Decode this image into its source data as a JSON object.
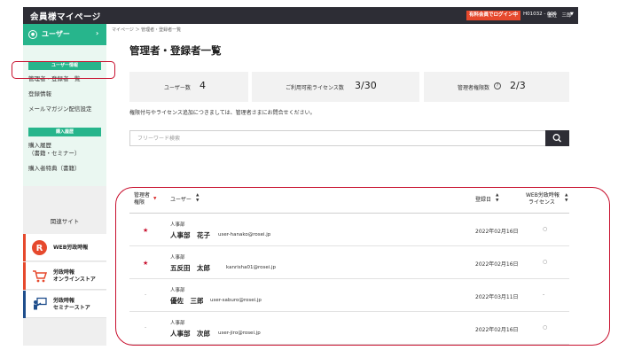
{
  "header": {
    "brand": "会員様マイページ",
    "login_badge": "有料会員でログイン中",
    "user_id": "H01032 - 000",
    "user_name": "優佐　三郎",
    "caret": "▼"
  },
  "sidebar": {
    "user_button": {
      "label": "ユーザー",
      "icon": "user-circle-icon",
      "chevron": "›"
    },
    "sections": [
      {
        "label": "ユーザー情報"
      },
      {
        "label": "購入履歴"
      }
    ],
    "links": [
      "管理者・登録者一覧",
      "登録情報",
      "メールマガジン配信設定",
      "購入履歴",
      "（書籍・セミナー）",
      "購入者特典（書籍）"
    ],
    "related_title": "関連サイト",
    "related": [
      {
        "line1": "WEB労政時報",
        "line2": "",
        "icon": "web-rosei-logo-icon",
        "color": "#e6492d"
      },
      {
        "line1": "労政時報",
        "line2": "オンラインストア",
        "icon": "shopping-cart-icon",
        "color": "#e6492d"
      },
      {
        "line1": "労政時報",
        "line2": "セミナーストア",
        "icon": "seminar-presenter-icon",
        "color": "#1f4e8c"
      }
    ]
  },
  "breadcrumb": "マイページ ＞ 管理者・登録者一覧",
  "page_title": "管理者・登録者一覧",
  "stats": {
    "users": {
      "label": "ユーザー数",
      "value": "4"
    },
    "licenses": {
      "label": "ご利用可能ライセンス数",
      "value": "3/30"
    },
    "admins": {
      "label": "管理者権限数",
      "value": "2/3",
      "icon": "help-circle-icon"
    }
  },
  "notice": "権限付与やライセンス追加につきましては、管理者さまにお問合せください。",
  "search": {
    "placeholder": "フリーワード検索",
    "value": "",
    "icon": "search-icon"
  },
  "table": {
    "headers": {
      "admin_line1": "管理者",
      "admin_line2": "権限",
      "user": "ユーザー",
      "date": "登録日",
      "license_line1": "WEB労政時報",
      "license_line2": "ライセンス"
    },
    "rows": [
      {
        "admin": "★",
        "dept": "人事部",
        "name": "人事部　花子",
        "email": "user-hanako@rosei.jp",
        "date": "2022年02月16日",
        "license": "○"
      },
      {
        "admin": "★",
        "dept": "人事部",
        "name": "五反田　太郎",
        "email": "kanrisha01@rosei.jp",
        "date": "2022年02月16日",
        "license": "○"
      },
      {
        "admin": "-",
        "dept": "人事部",
        "name": "優佐　三郎",
        "email": "user-saburo@rosei.jp",
        "date": "2022年03月11日",
        "license": "-"
      },
      {
        "admin": "-",
        "dept": "人事部",
        "name": "人事部　次郎",
        "email": "user-jiro@rosei.jp",
        "date": "2022年02月16日",
        "license": "○"
      }
    ]
  },
  "colors": {
    "accent": "#27b58c",
    "header_bg": "#2d2d35",
    "highlight": "#c8102e",
    "badge": "#e6492d"
  }
}
